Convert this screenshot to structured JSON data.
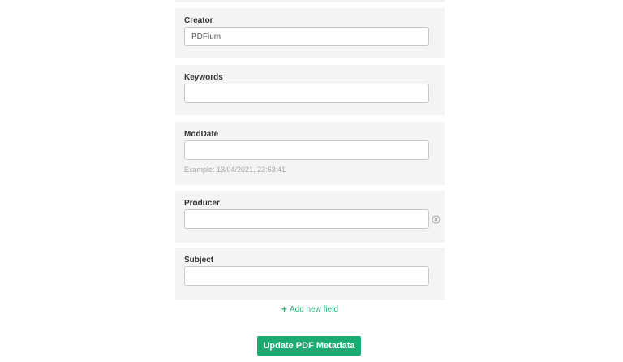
{
  "form": {
    "fields": [
      {
        "label": "Creator",
        "value": "PDFium",
        "placeholder": ""
      },
      {
        "label": "Keywords",
        "value": "",
        "placeholder": ""
      },
      {
        "label": "ModDate",
        "value": "",
        "placeholder": "",
        "hint": "Example: 13/04/2021, 23:53:41"
      },
      {
        "label": "Producer",
        "value": "",
        "placeholder": "",
        "remove_icon": "circle-x-icon"
      },
      {
        "label": "Subject",
        "value": "",
        "placeholder": ""
      }
    ],
    "add_field_label": "Add new field",
    "add_field_icon": "plus-icon",
    "submit_label": "Update PDF Metadata"
  },
  "colors": {
    "card_background": "#f4f4f4",
    "accent_green": "#1aaa72",
    "link_green": "#2fb07b",
    "hint_gray": "#a6a6a6"
  }
}
